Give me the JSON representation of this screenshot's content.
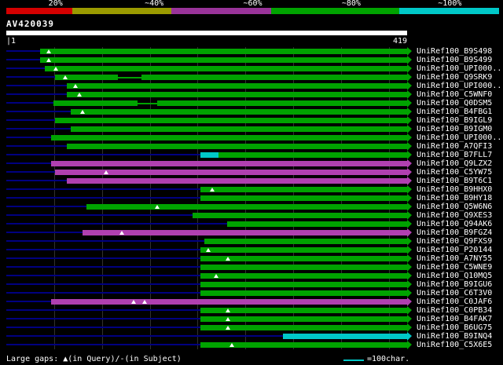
{
  "chart_data": {
    "type": "bar",
    "title": "AV420039",
    "query": {
      "name": "AV420039",
      "start_label": "|1",
      "end_label": "419",
      "length": 419
    },
    "scale_legend": {
      "labels": [
        "20%",
        "~40%",
        "~60%",
        "~80%",
        "~100%"
      ],
      "colors": [
        "#d40000",
        "#9a9a00",
        "#993399",
        "#00a300",
        "#00c8c8"
      ],
      "widths_pct": [
        13.4,
        20.1,
        20.3,
        26.0,
        20.2
      ]
    },
    "colors": {
      "green": "#00a300",
      "magenta": "#b040b0",
      "cyan": "#00c8c8",
      "baseline": "#000080",
      "grid": "#303030",
      "query_bar": "#ffffff",
      "gap_marker": "#ffffff"
    },
    "grid_interval": 50,
    "hits": [
      {
        "label": "UniRef100_B9S498",
        "color": "green",
        "start": 35,
        "end": 419,
        "gaps": [
          44
        ]
      },
      {
        "label": "UniRef100_B9S499",
        "color": "green",
        "start": 35,
        "end": 419,
        "gaps": [
          44
        ]
      },
      {
        "label": "UniRef100_UPI000..",
        "color": "green",
        "start": 40,
        "end": 419,
        "gaps": [
          52
        ]
      },
      {
        "label": "UniRef100_Q9SRK9",
        "color": "green",
        "start": 51,
        "end": 419,
        "gaps": [
          62
        ],
        "segments": [
          {
            "color": "green",
            "start": 51,
            "end": 117
          },
          {
            "color": "green",
            "start": 117,
            "end": 141,
            "thin": true
          },
          {
            "color": "green",
            "start": 141,
            "end": 419
          }
        ]
      },
      {
        "label": "UniRef100_UPI000..",
        "color": "green",
        "start": 63,
        "end": 419,
        "gaps": [
          72
        ]
      },
      {
        "label": "UniRef100_C5WNF0",
        "color": "green",
        "start": 63,
        "end": 419,
        "gaps": [
          76
        ]
      },
      {
        "label": "UniRef100_Q0DSM5",
        "color": "green",
        "start": 49,
        "end": 419,
        "gaps": [],
        "segments": [
          {
            "color": "green",
            "start": 49,
            "end": 137
          },
          {
            "color": "green",
            "start": 137,
            "end": 158,
            "thin": true
          },
          {
            "color": "green",
            "start": 158,
            "end": 419
          }
        ]
      },
      {
        "label": "UniRef100_B4FBG1",
        "color": "green",
        "start": 67,
        "end": 419,
        "gaps": [
          80
        ]
      },
      {
        "label": "UniRef100_B9IGL9",
        "color": "green",
        "start": 51,
        "end": 419,
        "gaps": []
      },
      {
        "label": "UniRef100_B9IGM0",
        "color": "green",
        "start": 67,
        "end": 419,
        "gaps": []
      },
      {
        "label": "UniRef100_UPI000..",
        "color": "green",
        "start": 47,
        "end": 419,
        "gaps": []
      },
      {
        "label": "UniRef100_A7QFI3",
        "color": "green",
        "start": 63,
        "end": 419,
        "gaps": []
      },
      {
        "label": "UniRef100_B7FLL7",
        "color": "green",
        "start": 203,
        "end": 419,
        "gaps": [],
        "segments": [
          {
            "color": "cyan",
            "start": 203,
            "end": 222
          },
          {
            "color": "green",
            "start": 222,
            "end": 419
          }
        ]
      },
      {
        "label": "UniRef100_Q9LZX2",
        "color": "magenta",
        "start": 47,
        "end": 419,
        "gaps": []
      },
      {
        "label": "UniRef100_C5YW75",
        "color": "magenta",
        "start": 51,
        "end": 419,
        "gaps": [
          104
        ]
      },
      {
        "label": "UniRef100_B9T6C1",
        "color": "magenta",
        "start": 63,
        "end": 419,
        "gaps": []
      },
      {
        "label": "UniRef100_B9HHX0",
        "color": "green",
        "start": 203,
        "end": 419,
        "gaps": [
          215
        ]
      },
      {
        "label": "UniRef100_B9HY18",
        "color": "green",
        "start": 203,
        "end": 419,
        "gaps": []
      },
      {
        "label": "UniRef100_Q5W6N6",
        "color": "green",
        "start": 84,
        "end": 419,
        "gaps": [
          158
        ]
      },
      {
        "label": "UniRef100_Q9XES3",
        "color": "green",
        "start": 195,
        "end": 419,
        "gaps": []
      },
      {
        "label": "UniRef100_Q94AK6",
        "color": "green",
        "start": 231,
        "end": 419,
        "gaps": []
      },
      {
        "label": "UniRef100_B9FGZ4",
        "color": "magenta",
        "start": 80,
        "end": 419,
        "gaps": [
          121
        ]
      },
      {
        "label": "UniRef100_Q9FXS9",
        "color": "green",
        "start": 207,
        "end": 419,
        "gaps": []
      },
      {
        "label": "UniRef100_P20144",
        "color": "green",
        "start": 203,
        "end": 419,
        "gaps": [
          211
        ]
      },
      {
        "label": "UniRef100_A7NY55",
        "color": "green",
        "start": 203,
        "end": 419,
        "gaps": [
          232
        ]
      },
      {
        "label": "UniRef100_C5WNE9",
        "color": "green",
        "start": 203,
        "end": 419,
        "gaps": []
      },
      {
        "label": "UniRef100_Q10MQ5",
        "color": "green",
        "start": 203,
        "end": 419,
        "gaps": [
          219
        ]
      },
      {
        "label": "UniRef100_B9IGU6",
        "color": "green",
        "start": 203,
        "end": 419,
        "gaps": []
      },
      {
        "label": "UniRef100_C6T3V0",
        "color": "green",
        "start": 203,
        "end": 419,
        "gaps": []
      },
      {
        "label": "UniRef100_C0JAF6",
        "color": "magenta",
        "start": 47,
        "end": 419,
        "gaps": [
          133,
          145
        ]
      },
      {
        "label": "UniRef100_C0PB34",
        "color": "green",
        "start": 203,
        "end": 419,
        "gaps": [
          232
        ]
      },
      {
        "label": "UniRef100_B4FAK7",
        "color": "green",
        "start": 203,
        "end": 419,
        "gaps": [
          232
        ]
      },
      {
        "label": "UniRef100_B6UG75",
        "color": "green",
        "start": 203,
        "end": 419,
        "gaps": [
          232
        ]
      },
      {
        "label": "UniRef100_B9INQ4",
        "color": "cyan",
        "start": 289,
        "end": 419,
        "gaps": []
      },
      {
        "label": "UniRef100_C5X6E5",
        "color": "green",
        "start": 203,
        "end": 419,
        "gaps": [
          236
        ]
      }
    ],
    "footer": {
      "gaps_legend": "Large gaps: ▲(in Query)/-(in Subject)",
      "scale_note": "=100char."
    }
  }
}
